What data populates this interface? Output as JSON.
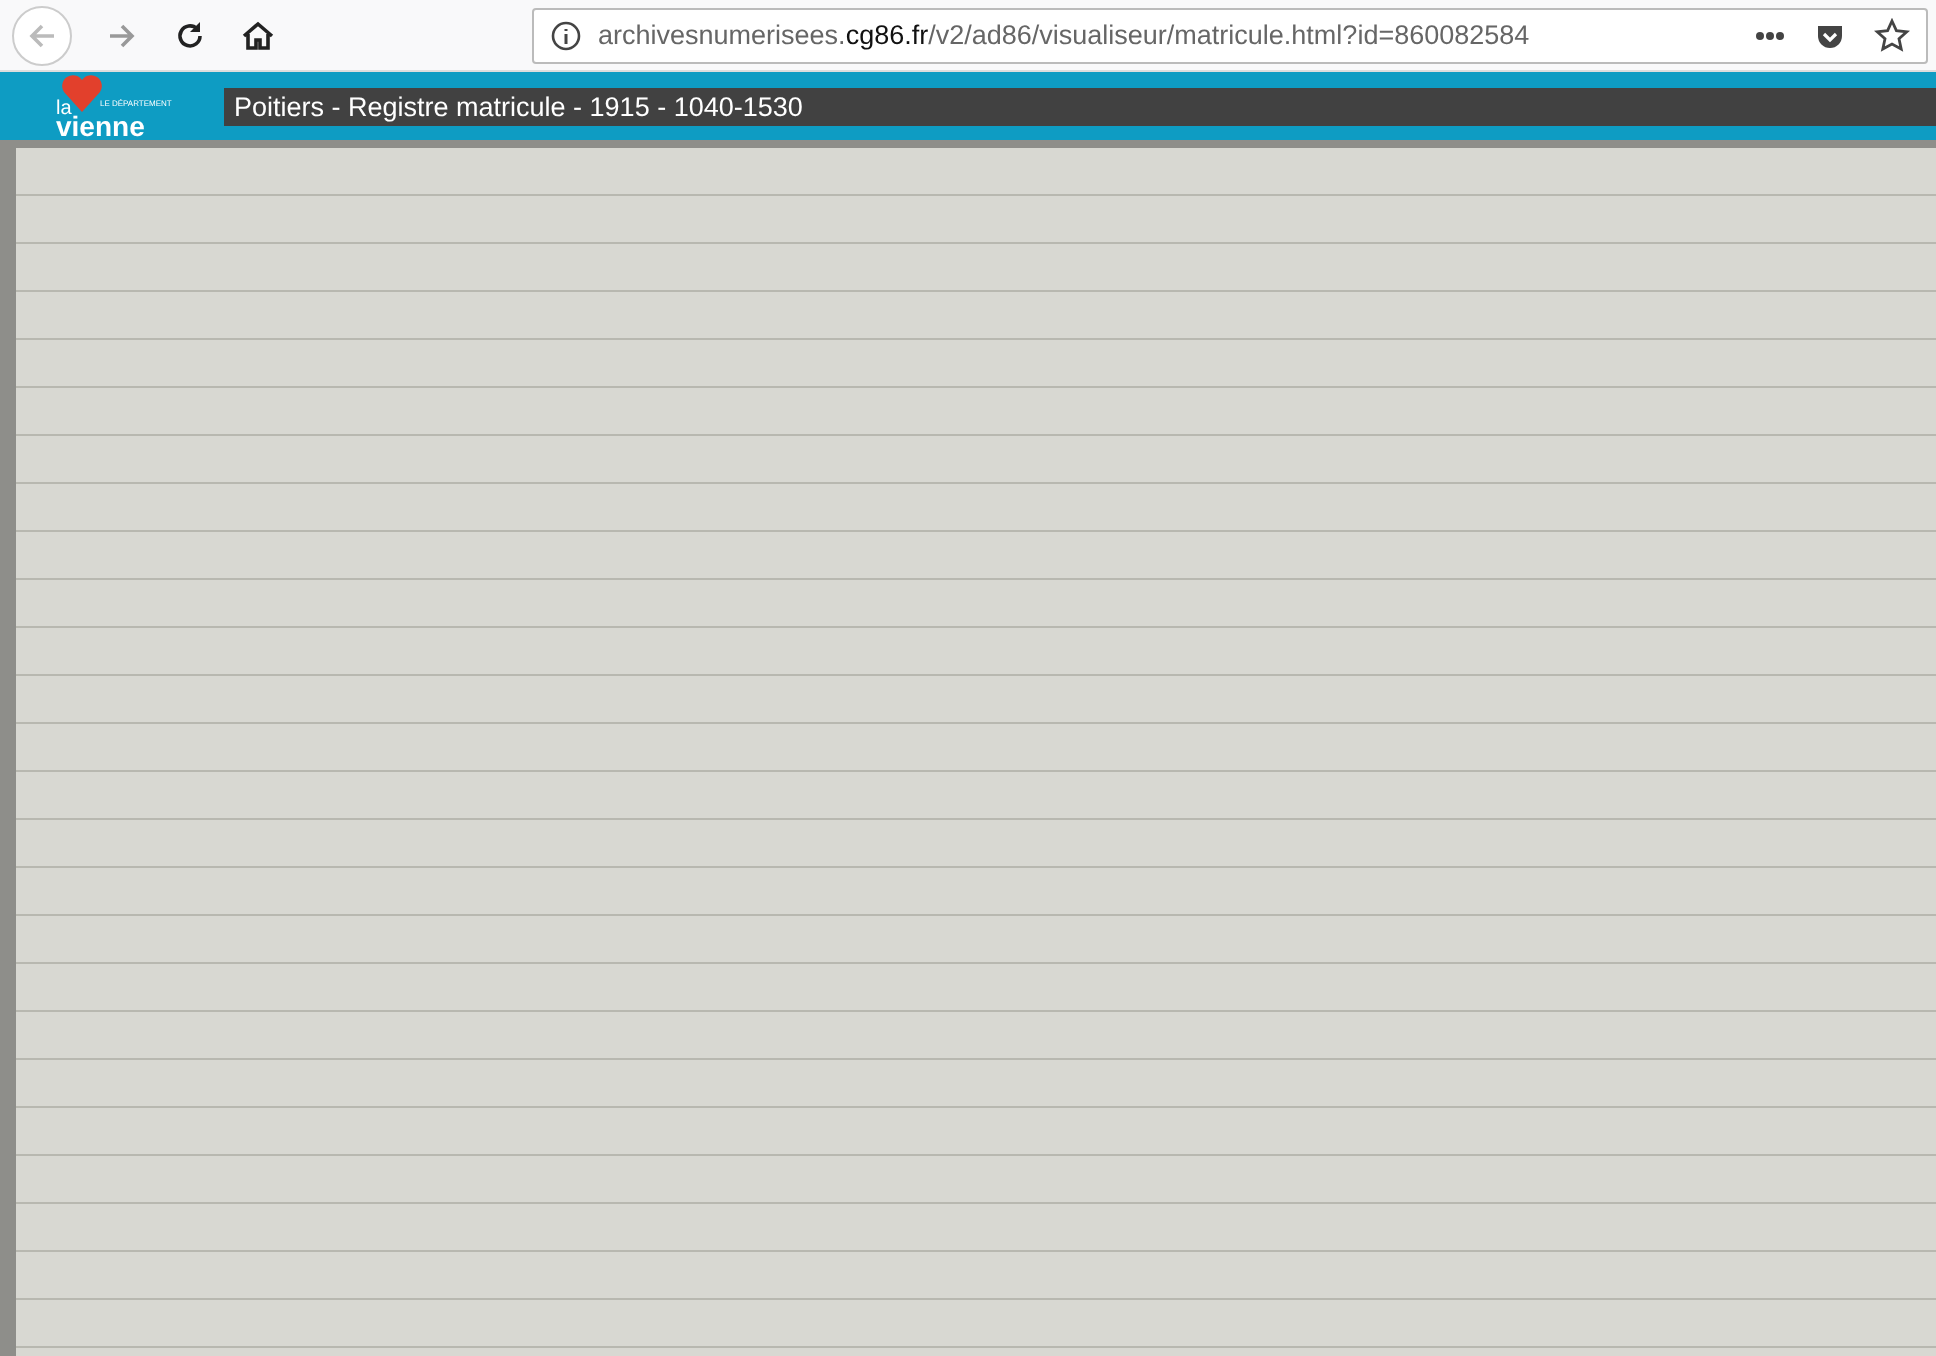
{
  "browser": {
    "url": "archivesnumerisees.**cg86.fr**/v2/ad86/visualiseur/matricule.html?id=860082584"
  },
  "site": {
    "logo": {
      "top": "la",
      "small": "LE DÉPARTEMENT",
      "bottom": "vienne"
    },
    "title": "Poitiers - Registre matricule - 1915 - 1040-1530"
  }
}
